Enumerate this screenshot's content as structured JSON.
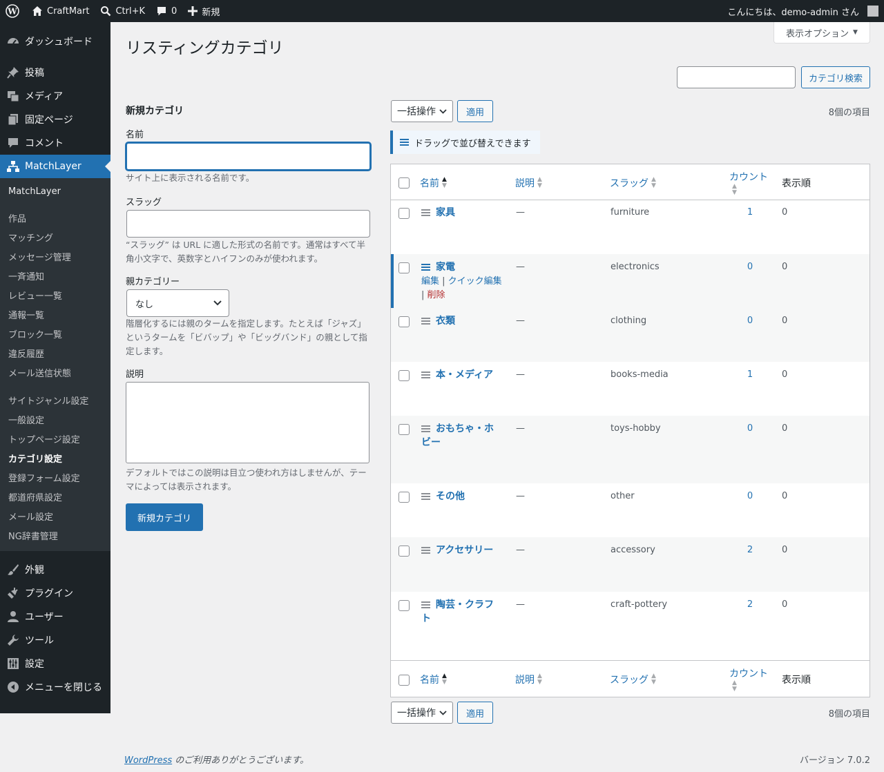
{
  "adminbar": {
    "site_name": "CraftMart",
    "search_label": "Ctrl+K",
    "comments_count": "0",
    "new_label": "新規",
    "greeting": "こんにちは、demo-admin さん"
  },
  "sidebar": {
    "dashboard": "ダッシュボード",
    "posts": "投稿",
    "media": "メディア",
    "pages": "固定ページ",
    "comments": "コメント",
    "matchlayer": "MatchLayer",
    "submenu": {
      "head": "MatchLayer",
      "group1": [
        "作品",
        "マッチング",
        "メッセージ管理",
        "一斉通知",
        "レビュー一覧",
        "通報一覧",
        "ブロック一覧",
        "違反履歴",
        "メール送信状態"
      ],
      "group2": [
        "サイトジャンル設定",
        "一般設定",
        "トップページ設定",
        "カテゴリ設定",
        "登録フォーム設定",
        "都道府県設定",
        "メール設定",
        "NG辞書管理"
      ]
    },
    "appearance": "外観",
    "plugins": "プラグイン",
    "users": "ユーザー",
    "tools": "ツール",
    "settings": "設定",
    "collapse": "メニューを閉じる"
  },
  "page": {
    "screen_options": "表示オプション",
    "title": "リスティングカテゴリ",
    "search_button": "カテゴリ検索"
  },
  "form": {
    "heading": "新規カテゴリ",
    "name_label": "名前",
    "name_desc": "サイト上に表示される名前です。",
    "slug_label": "スラッグ",
    "slug_desc": "“スラッグ” は URL に適した形式の名前です。通常はすべて半角小文字で、英数字とハイフンのみが使われます。",
    "parent_label": "親カテゴリー",
    "parent_value": "なし",
    "parent_desc": "階層化するには親のタームを指定します。たとえば「ジャズ」というタームを「ビバップ」や「ビッグバンド」の親として指定します。",
    "desc_label": "説明",
    "desc_desc": "デフォルトではこの説明は目立つ使われ方はしませんが、テーマによっては表示されます。",
    "submit": "新規カテゴリ"
  },
  "list": {
    "bulk_label": "一括操作",
    "apply_label": "適用",
    "items_count": "8個の項目",
    "drag_notice": "ドラッグで並び替えできます",
    "columns": {
      "name": "名前",
      "description": "説明",
      "slug": "スラッグ",
      "count": "カウント",
      "order": "表示順"
    },
    "row_actions": {
      "edit": "編集",
      "quick_edit": "クイック編集",
      "delete": "削除"
    },
    "rows": [
      {
        "name": "家具",
        "description": "—",
        "slug": "furniture",
        "count": "1",
        "order": "0"
      },
      {
        "name": "家電",
        "description": "—",
        "slug": "electronics",
        "count": "0",
        "order": "0"
      },
      {
        "name": "衣類",
        "description": "—",
        "slug": "clothing",
        "count": "0",
        "order": "0"
      },
      {
        "name": "本・メディア",
        "description": "—",
        "slug": "books-media",
        "count": "1",
        "order": "0"
      },
      {
        "name": "おもちゃ・ホビー",
        "description": "—",
        "slug": "toys-hobby",
        "count": "0",
        "order": "0"
      },
      {
        "name": "その他",
        "description": "—",
        "slug": "other",
        "count": "0",
        "order": "0"
      },
      {
        "name": "アクセサリー",
        "description": "—",
        "slug": "accessory",
        "count": "2",
        "order": "0"
      },
      {
        "name": "陶芸・クラフト",
        "description": "—",
        "slug": "craft-pottery",
        "count": "2",
        "order": "0"
      }
    ]
  },
  "footer": {
    "wp_link": "WordPress",
    "thanks": " のご利用ありがとうございます。",
    "version": "バージョン 7.0.2"
  }
}
